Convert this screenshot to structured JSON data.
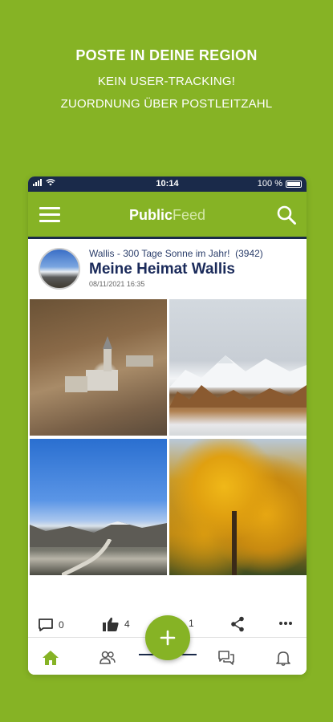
{
  "promo": {
    "title": "POSTE IN DEINE REGION",
    "line1": "KEIN USER-TRACKING!",
    "line2": "ZUORDNUNG ÜBER POSTLEITZAHL"
  },
  "statusbar": {
    "time": "10:14",
    "battery": "100 %"
  },
  "appbar": {
    "title_bold": "Public",
    "title_light": "Feed"
  },
  "post": {
    "region": "Wallis - 300 Tage Sonne im Jahr!",
    "count": "(3942)",
    "title": "Meine Heimat Wallis",
    "date": "08/11/2021 16:35"
  },
  "actions": {
    "comments": "0",
    "likes": "4",
    "third": "1"
  },
  "colors": {
    "brand": "#86b325",
    "navy": "#1a2a4a"
  },
  "icons": [
    "menu-icon",
    "search-icon",
    "comment-icon",
    "thumbs-up-icon",
    "share-icon",
    "more-icon",
    "home-icon",
    "people-icon",
    "chat-icon",
    "bell-icon",
    "plus-icon"
  ]
}
